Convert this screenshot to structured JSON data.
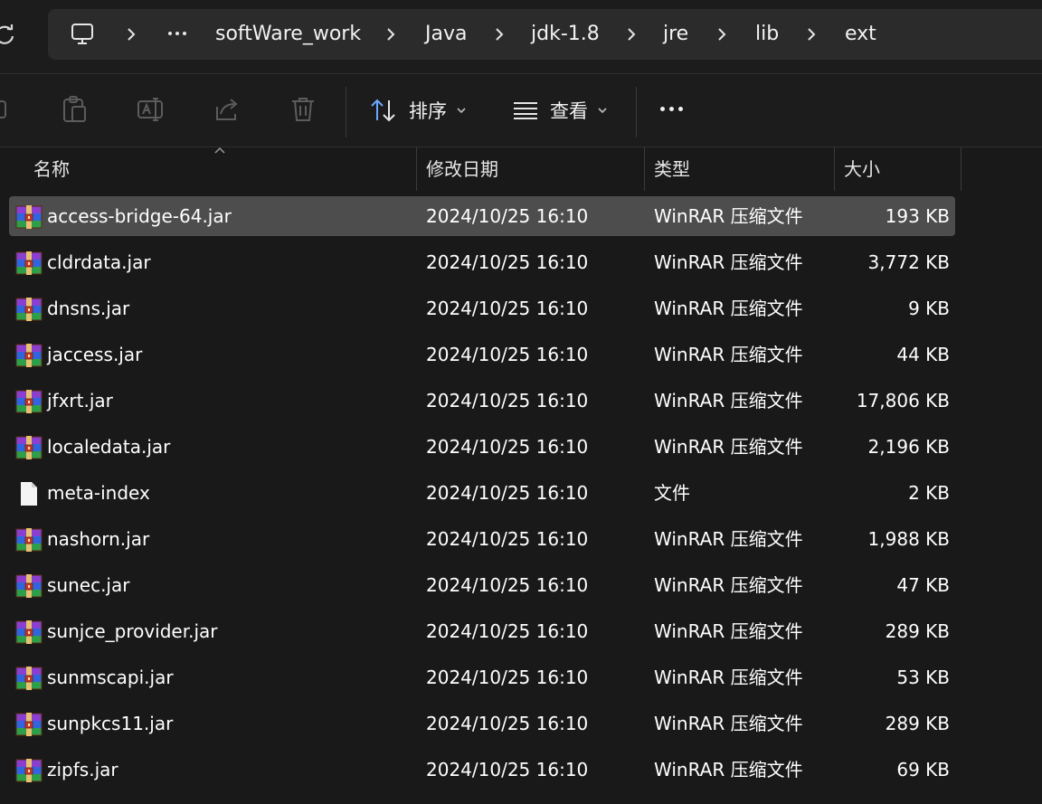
{
  "breadcrumb": {
    "items": [
      "softWare_work",
      "Java",
      "jdk-1.8",
      "jre",
      "lib",
      "ext"
    ]
  },
  "toolbar": {
    "sort_label": "排序",
    "view_label": "查看"
  },
  "columns": {
    "name": "名称",
    "date": "修改日期",
    "type": "类型",
    "size": "大小"
  },
  "files": [
    {
      "name": "access-bridge-64.jar",
      "date": "2024/10/25 16:10",
      "type": "WinRAR 压缩文件",
      "size": "193 KB",
      "icon": "winrar-archive-icon",
      "selected": true
    },
    {
      "name": "cldrdata.jar",
      "date": "2024/10/25 16:10",
      "type": "WinRAR 压缩文件",
      "size": "3,772 KB",
      "icon": "winrar-archive-icon"
    },
    {
      "name": "dnsns.jar",
      "date": "2024/10/25 16:10",
      "type": "WinRAR 压缩文件",
      "size": "9 KB",
      "icon": "winrar-archive-icon"
    },
    {
      "name": "jaccess.jar",
      "date": "2024/10/25 16:10",
      "type": "WinRAR 压缩文件",
      "size": "44 KB",
      "icon": "winrar-archive-icon"
    },
    {
      "name": "jfxrt.jar",
      "date": "2024/10/25 16:10",
      "type": "WinRAR 压缩文件",
      "size": "17,806 KB",
      "icon": "winrar-archive-icon"
    },
    {
      "name": "localedata.jar",
      "date": "2024/10/25 16:10",
      "type": "WinRAR 压缩文件",
      "size": "2,196 KB",
      "icon": "winrar-archive-icon"
    },
    {
      "name": "meta-index",
      "date": "2024/10/25 16:10",
      "type": "文件",
      "size": "2 KB",
      "icon": "blank-file-icon"
    },
    {
      "name": "nashorn.jar",
      "date": "2024/10/25 16:10",
      "type": "WinRAR 压缩文件",
      "size": "1,988 KB",
      "icon": "winrar-archive-icon"
    },
    {
      "name": "sunec.jar",
      "date": "2024/10/25 16:10",
      "type": "WinRAR 压缩文件",
      "size": "47 KB",
      "icon": "winrar-archive-icon"
    },
    {
      "name": "sunjce_provider.jar",
      "date": "2024/10/25 16:10",
      "type": "WinRAR 压缩文件",
      "size": "289 KB",
      "icon": "winrar-archive-icon"
    },
    {
      "name": "sunmscapi.jar",
      "date": "2024/10/25 16:10",
      "type": "WinRAR 压缩文件",
      "size": "53 KB",
      "icon": "winrar-archive-icon"
    },
    {
      "name": "sunpkcs11.jar",
      "date": "2024/10/25 16:10",
      "type": "WinRAR 压缩文件",
      "size": "289 KB",
      "icon": "winrar-archive-icon"
    },
    {
      "name": "zipfs.jar",
      "date": "2024/10/25 16:10",
      "type": "WinRAR 压缩文件",
      "size": "69 KB",
      "icon": "winrar-archive-icon"
    }
  ]
}
